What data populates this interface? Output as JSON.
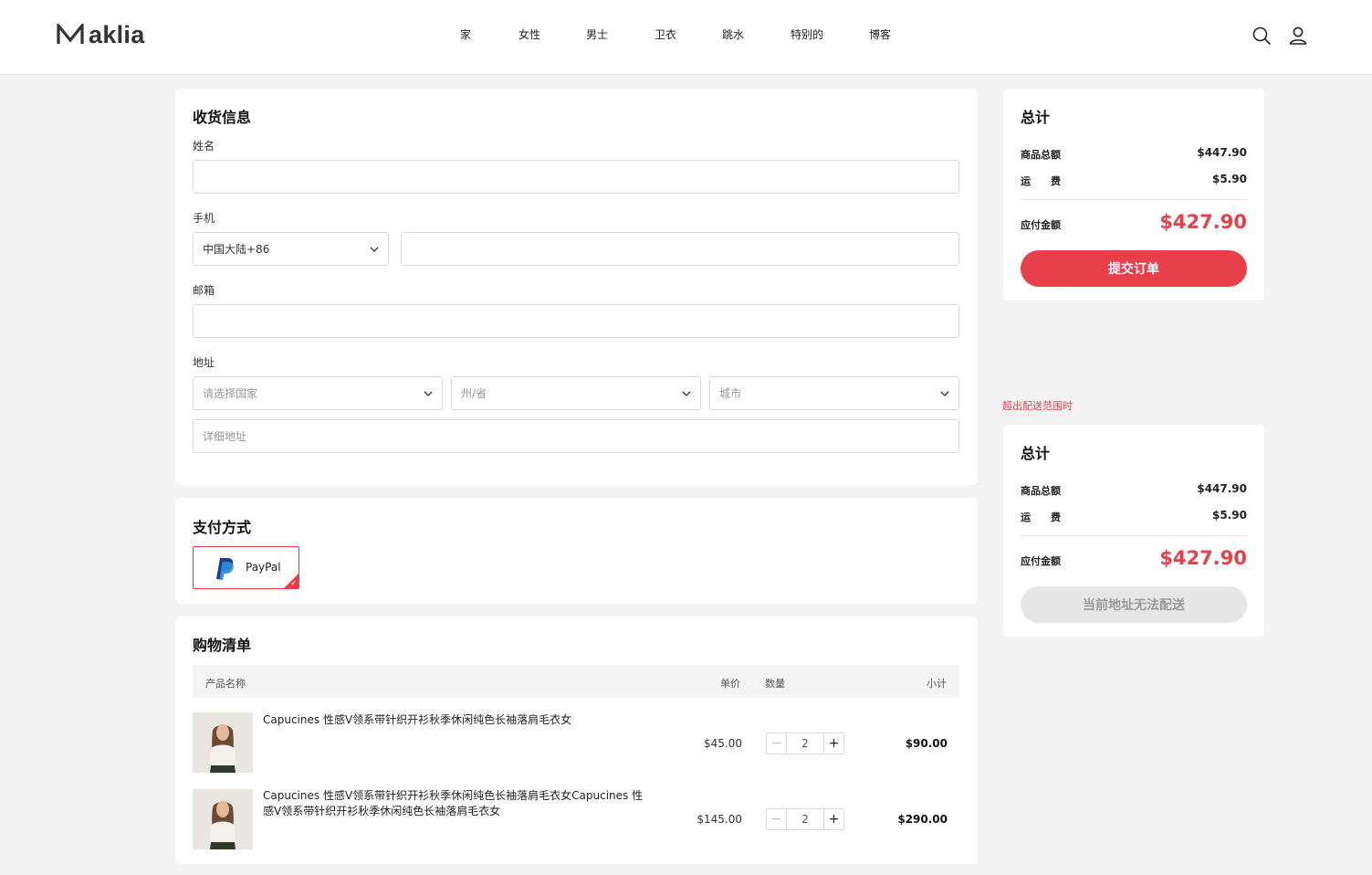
{
  "brand": {
    "logo_text": "aklia",
    "logo_alt": "Maklia"
  },
  "nav": [
    "家",
    "女性",
    "男士",
    "卫衣",
    "跳水",
    "特别的",
    "博客"
  ],
  "shipping": {
    "title": "收货信息",
    "name_label": "姓名",
    "name_value": "",
    "phone_label": "手机",
    "phone_region": "中国大陆+86",
    "phone_value": "",
    "email_label": "邮箱",
    "email_value": "",
    "address_label": "地址",
    "country_placeholder": "请选择国家",
    "state_placeholder": "州/省",
    "city_placeholder": "城市",
    "detail_placeholder": "详细地址"
  },
  "payment": {
    "title": "支付方式",
    "method": "PayPal",
    "selected": true
  },
  "cart": {
    "title": "购物清单",
    "headers": {
      "product": "产品名称",
      "price": "单价",
      "qty": "数量",
      "subtotal": "小计"
    },
    "items": [
      {
        "name": "Capucines 性感V领系带针织开衫秋季休闲纯色长袖落肩毛衣女",
        "price": "$45.00",
        "qty": "2",
        "subtotal": "$90.00"
      },
      {
        "name": "Capucines 性感V领系带针织开衫秋季休闲纯色长袖落肩毛衣女Capucines 性感V领系带针织开衫秋季休闲纯色长袖落肩毛衣女",
        "price": "$145.00",
        "qty": "2",
        "subtotal": "$290.00"
      }
    ],
    "minus": "−",
    "plus": "+"
  },
  "summary": {
    "title": "总计",
    "goods_label": "商品总额",
    "goods_value": "$447.90",
    "shipping_label": "运　　费",
    "shipping_value": "$5.90",
    "due_label": "应付金额",
    "due_value": "$427.90",
    "submit_label": "提交订单"
  },
  "summary_out_of_range": {
    "note": "超出配送范围时",
    "title": "总计",
    "goods_label": "商品总额",
    "goods_value": "$447.90",
    "shipping_label": "运　　费",
    "shipping_value": "$5.90",
    "due_label": "应付金额",
    "due_value": "$427.90",
    "disabled_label": "当前地址无法配送"
  },
  "colors": {
    "accent": "#e8404b",
    "page_bg": "#f3f3f3",
    "card_bg": "#ffffff",
    "disabled_bg": "#e6e6e6"
  },
  "icons": {
    "search": "search-icon",
    "user": "user-icon",
    "chevron": "chevron-down-icon",
    "paypal": "paypal-icon",
    "check": "check-icon"
  }
}
